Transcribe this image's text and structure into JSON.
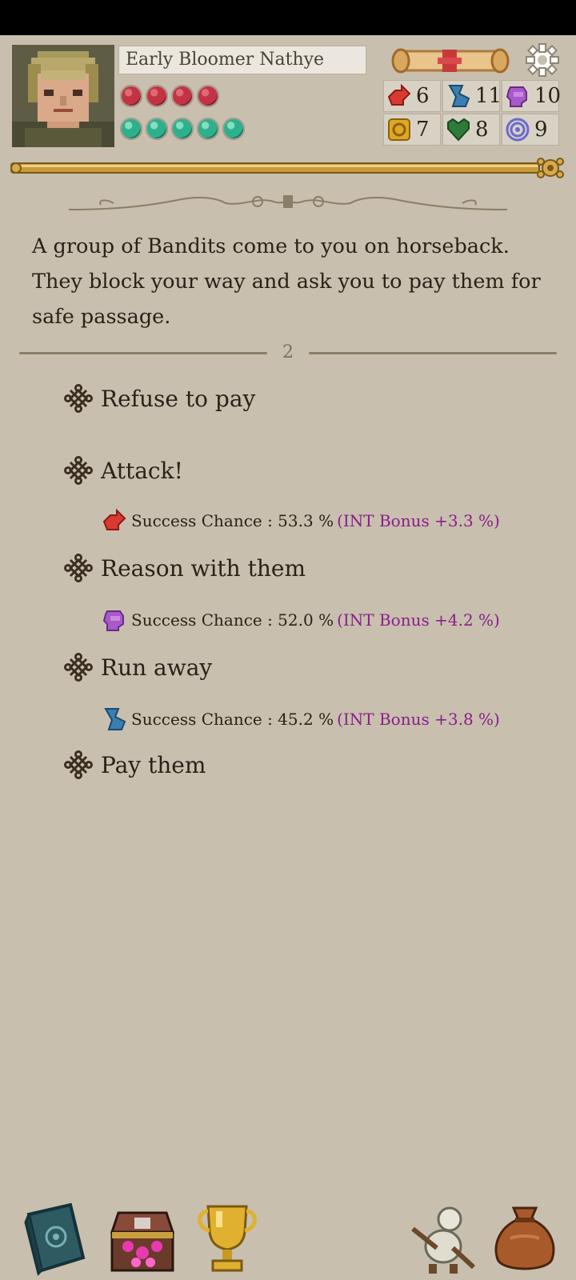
{
  "character": {
    "name": "Early Bloomer Nathye",
    "health": 4,
    "stamina": 5
  },
  "stats": [
    {
      "icon": "strength-fist-icon",
      "value": "6",
      "color": "#d83a32"
    },
    {
      "icon": "agility-boot-icon",
      "value": "11",
      "color": "#3a7fb0"
    },
    {
      "icon": "charisma-head-icon",
      "value": "10",
      "color": "#a85ac8"
    },
    {
      "icon": "luck-coin-icon",
      "value": "7",
      "color": "#e0a820"
    },
    {
      "icon": "vitality-heart-icon",
      "value": "8",
      "color": "#2e7a3a"
    },
    {
      "icon": "magic-ring-icon",
      "value": "9",
      "color": "#6a6ad0"
    }
  ],
  "event": {
    "text": " A group of Bandits come to you on horseback. They block your way and ask you to pay them for safe passage.",
    "page": "2"
  },
  "choices": [
    {
      "label": "Refuse to pay"
    },
    {
      "label": "Attack!",
      "chance_label": "Success Chance : 53.3 %",
      "bonus": "(INT Bonus +3.3 %)",
      "icon": "strength-fist-icon"
    },
    {
      "label": "Reason with them",
      "chance_label": "Success Chance : 52.0 %",
      "bonus": "(INT Bonus +4.2 %)",
      "icon": "charisma-head-icon"
    },
    {
      "label": "Run away",
      "chance_label": "Success Chance : 45.2 %",
      "bonus": "(INT Bonus +3.8 %)",
      "icon": "agility-boot-icon"
    },
    {
      "label": "Pay them"
    }
  ],
  "bottom_bar": {
    "left": [
      "journal-book-icon",
      "treasure-chest-icon",
      "trophy-icon"
    ],
    "right": [
      "companion-icon",
      "inventory-bag-icon"
    ]
  }
}
